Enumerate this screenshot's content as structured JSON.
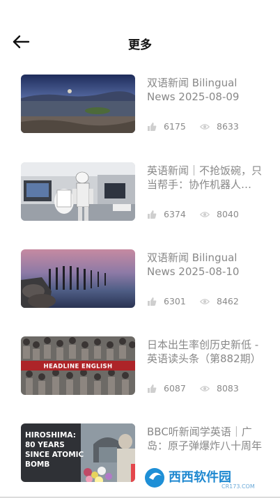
{
  "header": {
    "back_icon": "arrow-left-icon",
    "title": "更多"
  },
  "items": [
    {
      "title": "双语新闻 Bilingual News 2025-08-09",
      "likes": "6175",
      "views": "8633",
      "thumb": "seaside-sunset"
    },
    {
      "title": "英语新闻｜不抢饭碗，只当帮手：协作机器人走进工厂",
      "likes": "6374",
      "views": "8040",
      "thumb": "robot-lab"
    },
    {
      "title": "双语新闻 Bilingual News 2025-08-10",
      "likes": "6301",
      "views": "8462",
      "thumb": "pier-posts"
    },
    {
      "title": "日本出生率创历史新低 - 英语读头条（第882期）",
      "likes": "6087",
      "views": "8083",
      "thumb": "crowd-crossing",
      "thumb_caption": "HEADLINE ENGLISH"
    },
    {
      "title": "BBC听新闻学英语｜广岛：原子弹爆炸八十周年",
      "likes": "",
      "views": "",
      "thumb": "hiroshima-memorial",
      "thumb_caption_lines": [
        "HIROSHIMA:",
        "80 YEARS",
        "SINCE ATOMIC",
        "BOMB"
      ]
    }
  ],
  "watermark": {
    "text": "西西软件园",
    "sub": "CR173.COM"
  },
  "colors": {
    "title_text": "#888888",
    "stat_text": "#8a8a8a",
    "header_text": "#111111"
  }
}
